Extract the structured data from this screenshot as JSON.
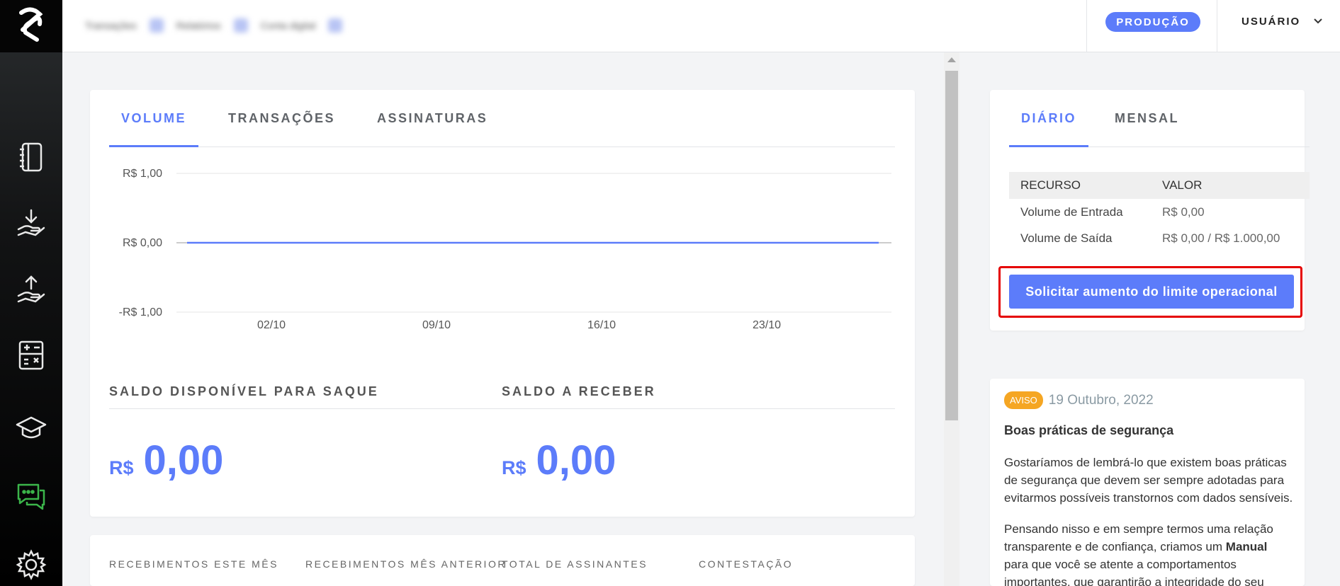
{
  "header": {
    "breadcrumbs": [
      "Transações",
      "Relatórios",
      "Conta digital"
    ],
    "environment_badge": "PRODUÇÃO",
    "user_menu_label": "USUÁRIO"
  },
  "sidebar": {
    "items": [
      {
        "icon": "notebook-icon"
      },
      {
        "icon": "receive-money-icon"
      },
      {
        "icon": "send-money-icon"
      },
      {
        "icon": "calculator-icon"
      },
      {
        "icon": "graduation-cap-icon"
      },
      {
        "icon": "chat-bubbles-icon",
        "active": true,
        "color": "#3bb54a"
      },
      {
        "icon": "gear-icon"
      }
    ]
  },
  "main": {
    "tabs": [
      {
        "label": "VOLUME",
        "active": true
      },
      {
        "label": "TRANSAÇÕES",
        "active": false
      },
      {
        "label": "ASSINATURAS",
        "active": false
      }
    ],
    "balance": {
      "available_label": "SALDO DISPONÍVEL PARA SAQUE",
      "available_currency": "R$",
      "available_value": "0,00",
      "receivable_label": "SALDO A RECEBER",
      "receivable_currency": "R$",
      "receivable_value": "0,00"
    },
    "stats_labels": [
      "RECEBIMENTOS ESTE MÊS",
      "RECEBIMENTOS MÊS ANTERIOR",
      "TOTAL DE ASSINANTES",
      "CONTESTAÇÃO"
    ]
  },
  "chart_data": {
    "type": "line",
    "x": [
      "02/10",
      "09/10",
      "16/10",
      "23/10"
    ],
    "series": [
      {
        "values": [
          0,
          0,
          0,
          0
        ]
      }
    ],
    "y_ticks": [
      "R$ 1,00",
      "R$ 0,00",
      "-R$ 1,00"
    ],
    "ylim": [
      -1,
      1
    ],
    "grid": true,
    "color": "#5c7cfa"
  },
  "limits": {
    "tabs": [
      {
        "label": "DIÁRIO",
        "active": true
      },
      {
        "label": "MENSAL",
        "active": false
      }
    ],
    "table": {
      "headers": [
        "RECURSO",
        "VALOR"
      ],
      "rows": [
        [
          "Volume de Entrada",
          "R$ 0,00"
        ],
        [
          "Volume de Saída",
          "R$ 0,00 / R$ 1.000,00"
        ]
      ]
    },
    "request_button": "Solicitar aumento do limite operacional"
  },
  "notice": {
    "badge": "AVISO",
    "date": "19 Outubro, 2022",
    "title": "Boas práticas de segurança",
    "paragraph1": "Gostaríamos de lembrá-lo que existem boas práticas de segurança que devem ser sempre adotadas para evitarmos possíveis transtornos com dados sensíveis.",
    "paragraph2_before": "Pensando nisso e em sempre termos uma relação transparente e de confiança, criamos um ",
    "paragraph2_bold": "Manual",
    "paragraph2_after": " para que você se atente a comportamentos importantes, que garantirão a integridade do seu"
  },
  "colors": {
    "accent": "#5c7cfa",
    "warning": "#f5a623",
    "highlight": "#e50000"
  }
}
